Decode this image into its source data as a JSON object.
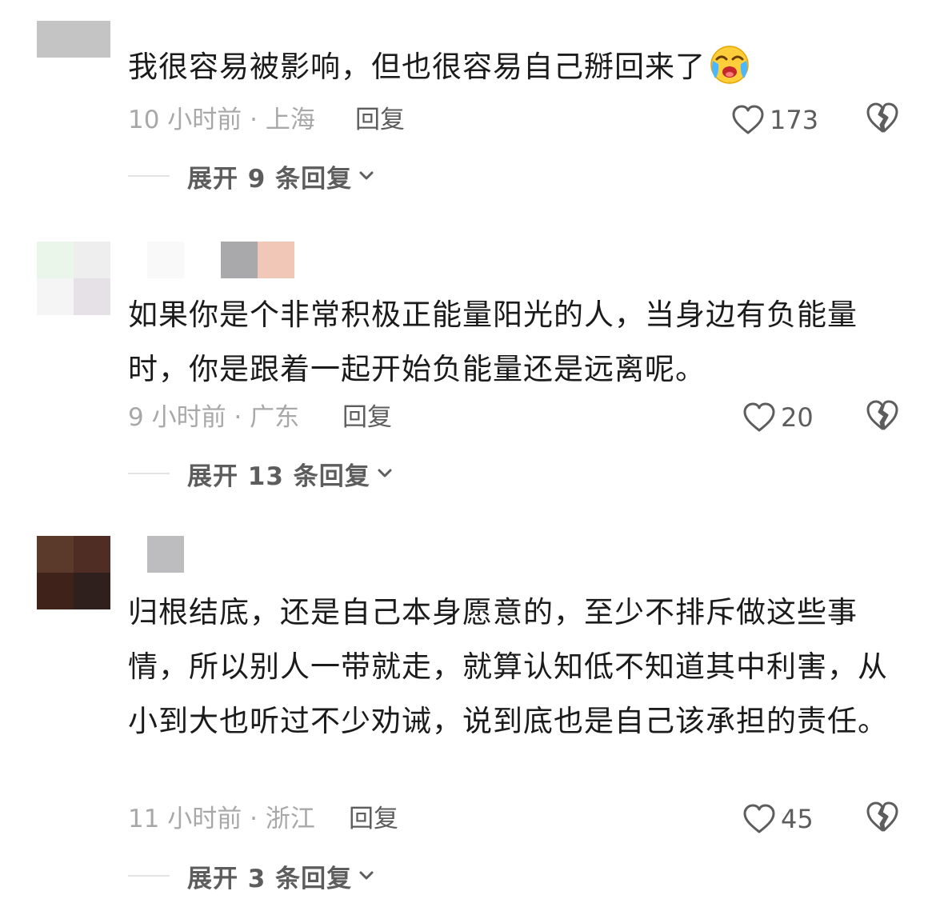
{
  "comments": [
    {
      "text": "我很容易被影响，但也很容易自己掰回来了",
      "emoji": "crying-laughing-emoji",
      "time_location": "10 小时前 · 上海",
      "reply_label": "回复",
      "likes": "173",
      "expand_label": "展开 9 条回复",
      "avatar_colors": [
        "#c4c4c4"
      ],
      "namebar_colors": []
    },
    {
      "text": "如果你是个非常积极正能量阳光的人，当身边有负能量时，你是跟着一起开始负能量还是远离呢。",
      "time_location": "9 小时前 · 广东",
      "reply_label": "回复",
      "likes": "20",
      "expand_label": "展开 13 条回复",
      "avatar_colors": [
        "#e9f6e9",
        "#eeeeee",
        "#f6f5f6",
        "#e6e1e6"
      ],
      "namebar_colors": [
        "#f9f9f9",
        "#ffffff",
        "#a9a9ab",
        "#f1c7b8"
      ]
    },
    {
      "text": "归根结底，还是自己本身愿意的，至少不排斥做这些事情，所以别人一带就走，就算认知低不知道其中利害，从小到大也听过不少劝诫，说到底也是自己该承担的责任。",
      "time_location": "11 小时前 · 浙江",
      "reply_label": "回复",
      "likes": "45",
      "expand_label": "展开 3 条回复",
      "avatar_colors": [
        "#5b3a2b",
        "#4f2c24",
        "#3f2219",
        "#2f1f1d"
      ],
      "namebar_colors": [
        "#bdbdbf"
      ]
    }
  ],
  "icons": {
    "like": "heart-outline-icon",
    "dislike": "broken-heart-icon",
    "expand": "chevron-down-icon"
  },
  "colors": {
    "primary_text": "#1b1b1b",
    "meta_text": "#a8a8a8",
    "action_text": "#5d5d5d"
  }
}
